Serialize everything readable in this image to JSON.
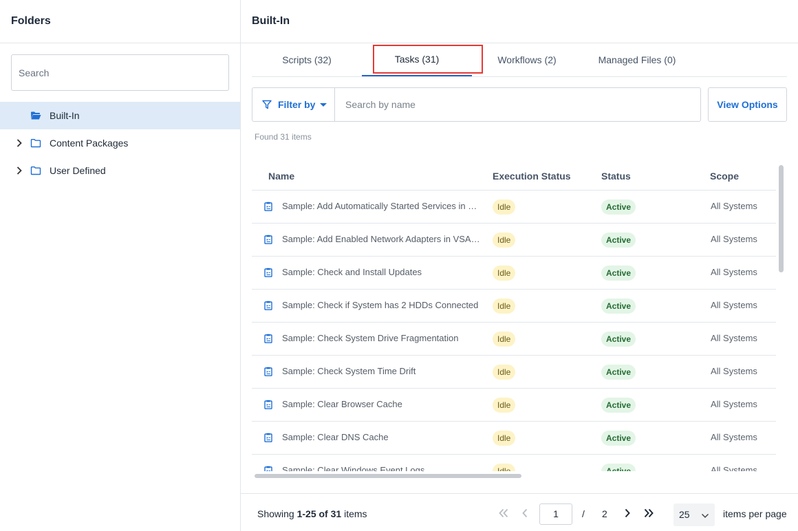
{
  "left": {
    "title": "Folders",
    "search_placeholder": "Search",
    "tree": [
      {
        "label": "Built-In",
        "selected": true,
        "expandable": false,
        "icon": "folder-open-icon"
      },
      {
        "label": "Content Packages",
        "selected": false,
        "expandable": true,
        "icon": "folder-icon"
      },
      {
        "label": "User Defined",
        "selected": false,
        "expandable": true,
        "icon": "folder-icon"
      }
    ]
  },
  "right": {
    "title": "Built-In",
    "tabs": [
      {
        "label": "Scripts (32)",
        "active": false
      },
      {
        "label": "Tasks (31)",
        "active": true
      },
      {
        "label": "Workflows (2)",
        "active": false
      },
      {
        "label": "Managed Files (0)",
        "active": false
      }
    ],
    "filter_label": "Filter by",
    "name_search_placeholder": "Search by name",
    "view_options_label": "View Options",
    "found_text": "Found 31 items"
  },
  "table": {
    "columns": [
      "Name",
      "Execution Status",
      "Status",
      "Scope"
    ],
    "rows": [
      {
        "name": "Sample: Add Automatically Started Services in …",
        "exec": "Idle",
        "status": "Active",
        "scope": "All Systems"
      },
      {
        "name": "Sample: Add Enabled Network Adapters in VSA…",
        "exec": "Idle",
        "status": "Active",
        "scope": "All Systems"
      },
      {
        "name": "Sample: Check and Install Updates",
        "exec": "Idle",
        "status": "Active",
        "scope": "All Systems"
      },
      {
        "name": "Sample: Check if System has 2 HDDs Connected",
        "exec": "Idle",
        "status": "Active",
        "scope": "All Systems"
      },
      {
        "name": "Sample: Check System Drive Fragmentation",
        "exec": "Idle",
        "status": "Active",
        "scope": "All Systems"
      },
      {
        "name": "Sample: Check System Time Drift",
        "exec": "Idle",
        "status": "Active",
        "scope": "All Systems"
      },
      {
        "name": "Sample: Clear Browser Cache",
        "exec": "Idle",
        "status": "Active",
        "scope": "All Systems"
      },
      {
        "name": "Sample: Clear DNS Cache",
        "exec": "Idle",
        "status": "Active",
        "scope": "All Systems"
      },
      {
        "name": "Sample: Clear Windows Event Logs",
        "exec": "Idle",
        "status": "Active",
        "scope": "All Systems"
      }
    ]
  },
  "footer": {
    "showing_prefix": "Showing ",
    "showing_range": "1-25 of 31",
    "showing_suffix": " items",
    "page": "1",
    "slash": "/",
    "total_pages": "2",
    "per_page": "25",
    "per_page_label": "items per page"
  },
  "colors": {
    "accent": "#1e6fd6",
    "selected_bg": "#deeaf7",
    "idle_bg": "#fdf3c7",
    "active_bg": "#e3f5e6",
    "highlight": "#e53935"
  }
}
